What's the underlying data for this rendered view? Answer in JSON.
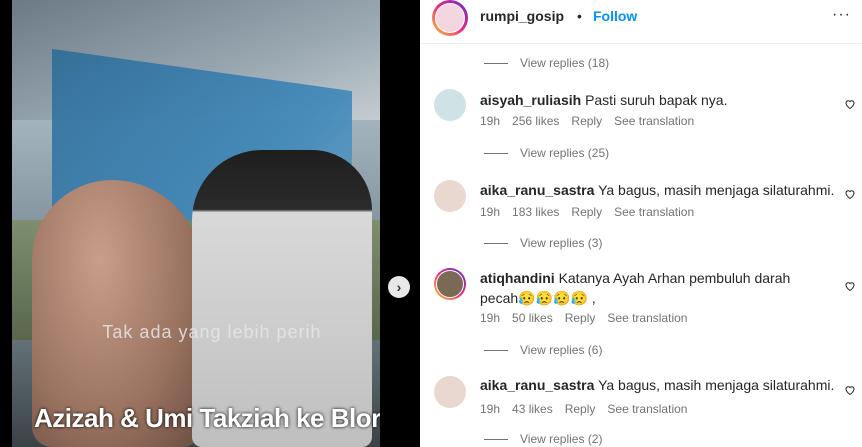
{
  "video": {
    "overlay_text": "Tak ada yang lebih perih",
    "caption": "Azizah & Umi Takziah ke Blora🥺"
  },
  "post": {
    "username": "rumpi_gosip",
    "separator": "•",
    "follow_label": "Follow",
    "more_label": "···"
  },
  "replies_top": "View replies (18)",
  "comments": [
    {
      "username": "aisyah_ruliasih",
      "text": "Pasti suruh bapak nya.",
      "time": "19h",
      "likes": "256 likes",
      "reply": "Reply",
      "translate": "See translation",
      "replies": "View replies (25)",
      "avatar_color": "#cfe2e6"
    },
    {
      "username": "aika_ranu_sastra",
      "text": "Ya bagus, masih menjaga silaturahmi.",
      "time": "19h",
      "likes": "183 likes",
      "reply": "Reply",
      "translate": "See translation",
      "replies": "View replies (3)",
      "avatar_color": "#e9d8d0"
    },
    {
      "username": "atiqhandini",
      "text": "Katanya Ayah Arhan pembuluh darah pecah😥😥😥😥 ,",
      "time": "19h",
      "likes": "50 likes",
      "reply": "Reply",
      "translate": "See translation",
      "replies": "View replies (6)",
      "avatar_color": "#7a6a55"
    },
    {
      "username": "aika_ranu_sastra",
      "text": "Ya bagus, masih menjaga silaturahmi.",
      "time": "19h",
      "likes": "43 likes",
      "reply": "Reply",
      "translate": "See translation",
      "replies": "View replies (2)",
      "avatar_color": "#e9d8d0"
    }
  ]
}
